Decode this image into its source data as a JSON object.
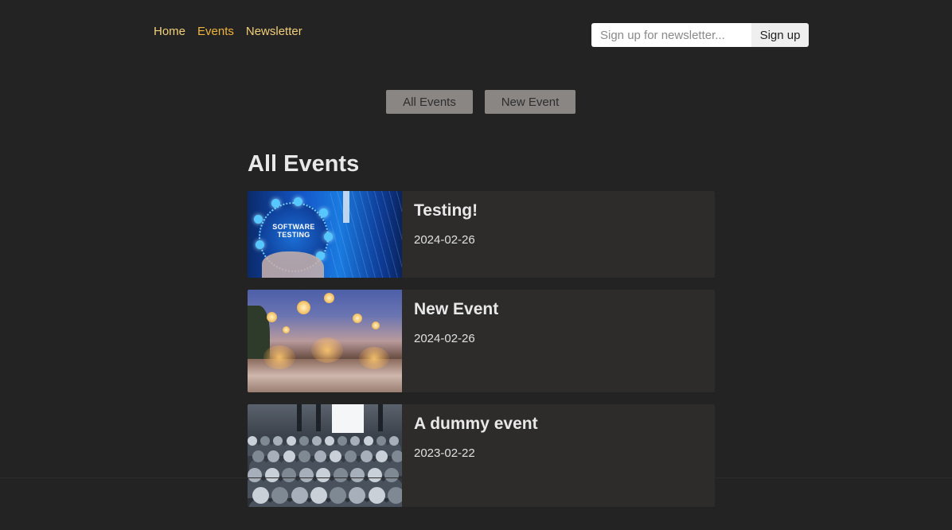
{
  "nav": {
    "items": [
      {
        "label": "Home"
      },
      {
        "label": "Events"
      },
      {
        "label": "Newsletter"
      }
    ]
  },
  "newsletter": {
    "placeholder": "Sign up for newsletter...",
    "button_label": "Sign up"
  },
  "actions": {
    "all_events_label": "All Events",
    "new_event_label": "New Event"
  },
  "main": {
    "heading": "All Events",
    "events": [
      {
        "title": "Testing!",
        "date": "2024-02-26",
        "image_text": "SOFTWARE TESTING"
      },
      {
        "title": "New Event",
        "date": "2024-02-26"
      },
      {
        "title": "A dummy event",
        "date": "2023-02-22"
      }
    ]
  },
  "colors": {
    "background": "#232323",
    "nav_link": "#f2cf7a",
    "nav_link_active": "#f0b43c",
    "card_background": "#2d2c2b",
    "action_button": "#8a8684"
  }
}
